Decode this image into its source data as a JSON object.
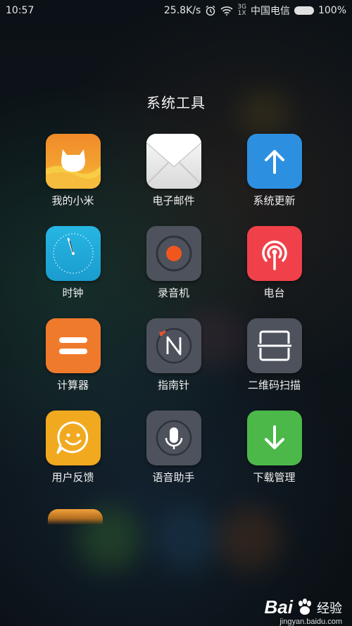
{
  "status_bar": {
    "time": "10:57",
    "speed": "25.8K/s",
    "network_type": "3G",
    "signal_tag": "1X",
    "carrier": "中国电信",
    "battery": "100%",
    "icons": [
      "alarm-icon",
      "wifi-icon",
      "signal-icon",
      "battery-icon"
    ]
  },
  "folder": {
    "title": "系统工具",
    "apps": [
      {
        "label": "我的小米",
        "icon": "mi-bunny-icon"
      },
      {
        "label": "电子邮件",
        "icon": "envelope-icon"
      },
      {
        "label": "系统更新",
        "icon": "arrow-up-icon"
      },
      {
        "label": "时钟",
        "icon": "clock-icon"
      },
      {
        "label": "录音机",
        "icon": "record-icon"
      },
      {
        "label": "电台",
        "icon": "radio-antenna-icon"
      },
      {
        "label": "计算器",
        "icon": "equals-icon"
      },
      {
        "label": "指南针",
        "icon": "compass-icon"
      },
      {
        "label": "二维码扫描",
        "icon": "scanner-icon"
      },
      {
        "label": "用户反馈",
        "icon": "smile-bubble-icon"
      },
      {
        "label": "语音助手",
        "icon": "microphone-icon"
      },
      {
        "label": "下载管理",
        "icon": "arrow-down-icon"
      }
    ]
  },
  "watermark": {
    "brand": "Bai",
    "brand_cn": "经验",
    "url": "jingyan.baidu.com"
  },
  "colors": {
    "orange": "#f07a2c",
    "blue": "#2d8fe0",
    "red": "#f0414a",
    "green": "#4cb849",
    "yellow": "#f1a920",
    "gray": "#4d525c",
    "cyan": "#1eaedb"
  }
}
